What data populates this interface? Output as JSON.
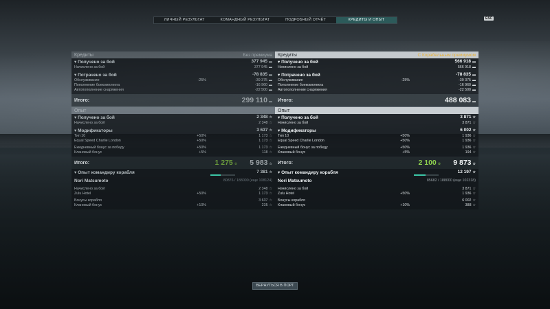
{
  "tabs": [
    "ЛИЧНЫЙ РЕЗУЛЬТАТ",
    "КОМАНДНЫЙ РЕЗУЛЬТАТ",
    "ПОДРОБНЫЙ ОТЧЁТ",
    "КРЕДИТЫ И ОПЫТ"
  ],
  "esc_key": "ESC",
  "left": {
    "credits_title": "Кредиты",
    "credits_tag": "Без премиума",
    "earned_label": "Получено за бой",
    "earned_value": "377 945",
    "accrued_label": "Начислено за бой",
    "accrued_value": "377 945",
    "spent_label": "Потрачено за бой",
    "spent_value": "-78 835",
    "service_label": "Обслуживание",
    "service_pct": "-25%",
    "service_value": "-39 375",
    "ammo_label": "Пополнение боекомплекта",
    "ammo_value": "-16 960",
    "consum_label": "Автопополнение снаряжения",
    "consum_value": "-22 500",
    "total_label": "Итого:",
    "total_credits": "299 110",
    "xp_title": "Опыт",
    "xp_earned_label": "Получено за бой",
    "xp_earned_value": "2 348",
    "xp_accrued_label": "Начислено за бой",
    "xp_accrued_value": "2 348",
    "mods_label": "Модификаторы",
    "mods_value": "3 637",
    "tier_label": "Тип 10",
    "tier_pct": "+50%",
    "tier_value": "1 173",
    "esc_label": "Equal Speed Charlie London",
    "esc_pct": "+50%",
    "esc_value": "1 173",
    "daily_label": "Ежедневный бонус за победу",
    "daily_pct": "+50%",
    "daily_value": "1 173",
    "clan_label": "Клановый бонус",
    "clan_pct": "+5%",
    "clan_value": "118",
    "xp_total_label": "Итого:",
    "xp_total_free": "1 275",
    "xp_total": "5 983",
    "cmdr_label": "Опыт командиру корабля",
    "cmdr_value": "7 381",
    "cmdr_name": "Nori Matsumoto",
    "cmdr_xp": "80876 / 188000 (еще 108124)",
    "cmdr_progress": 0.43,
    "cmdr_accrued_label": "Начислено за бой",
    "cmdr_accrued_value": "2 348",
    "zulu_label": "Zulu Hotel",
    "zulu_pct": "+50%",
    "zulu_value": "1 173",
    "ship_bonus_label": "Бонусы корабля",
    "ship_bonus_value": "3 637",
    "cmdr_clan_label": "Клановый бонус",
    "cmdr_clan_pct": "+10%",
    "cmdr_clan_value": "235"
  },
  "right": {
    "credits_title": "Кредиты",
    "credits_tag": "С Корабельным премиумом",
    "earned_label": "Получено за бой",
    "earned_value": "566 918",
    "accrued_label": "Начислено за бой",
    "accrued_value": "566 918",
    "spent_label": "Потрачено за бой",
    "spent_value": "-78 835",
    "service_label": "Обслуживание",
    "service_pct": "-25%",
    "service_value": "-39 375",
    "ammo_label": "Пополнение боекомплекта",
    "ammo_value": "-16 960",
    "consum_label": "Автопополнение снаряжения",
    "consum_value": "-22 500",
    "total_label": "Итого:",
    "total_credits": "488 083",
    "xp_title": "Опыт",
    "xp_earned_label": "Получено за бой",
    "xp_earned_value": "3 871",
    "xp_accrued_label": "Начислено за бой",
    "xp_accrued_value": "3 871",
    "mods_label": "Модификаторы",
    "mods_value": "6 002",
    "tier_label": "Тип 10",
    "tier_pct": "+50%",
    "tier_value": "1 936",
    "esc_label": "Equal Speed Charlie London",
    "esc_pct": "+50%",
    "esc_value": "1 936",
    "daily_label": "Ежедневный бонус за победу",
    "daily_pct": "+50%",
    "daily_value": "1 936",
    "clan_label": "Клановый бонус",
    "clan_pct": "+5%",
    "clan_value": "194",
    "xp_total_label": "Итого:",
    "xp_total_free": "2 100",
    "xp_total": "9 873",
    "cmdr_label": "Опыт командиру корабля",
    "cmdr_value": "12 197",
    "cmdr_name": "Nori Matsumoto",
    "cmdr_xp": "85682 / 188000 (еще 102318)",
    "cmdr_progress": 0.46,
    "cmdr_accrued_label": "Начислено за бой",
    "cmdr_accrued_value": "3 871",
    "zulu_label": "Zulu Hotel",
    "zulu_pct": "+50%",
    "zulu_value": "1 936",
    "ship_bonus_label": "Бонусы корабля",
    "ship_bonus_value": "6 002",
    "cmdr_clan_label": "Клановый бонус",
    "cmdr_clan_pct": "+10%",
    "cmdr_clan_value": "388"
  },
  "back_button": "ВЕРНУТЬСЯ В ПОРТ",
  "colors": {
    "accent": "#2c5a5a",
    "premium": "#e8b33a",
    "free_xp": "#8ed24e",
    "progress": "#3cc8a8"
  }
}
